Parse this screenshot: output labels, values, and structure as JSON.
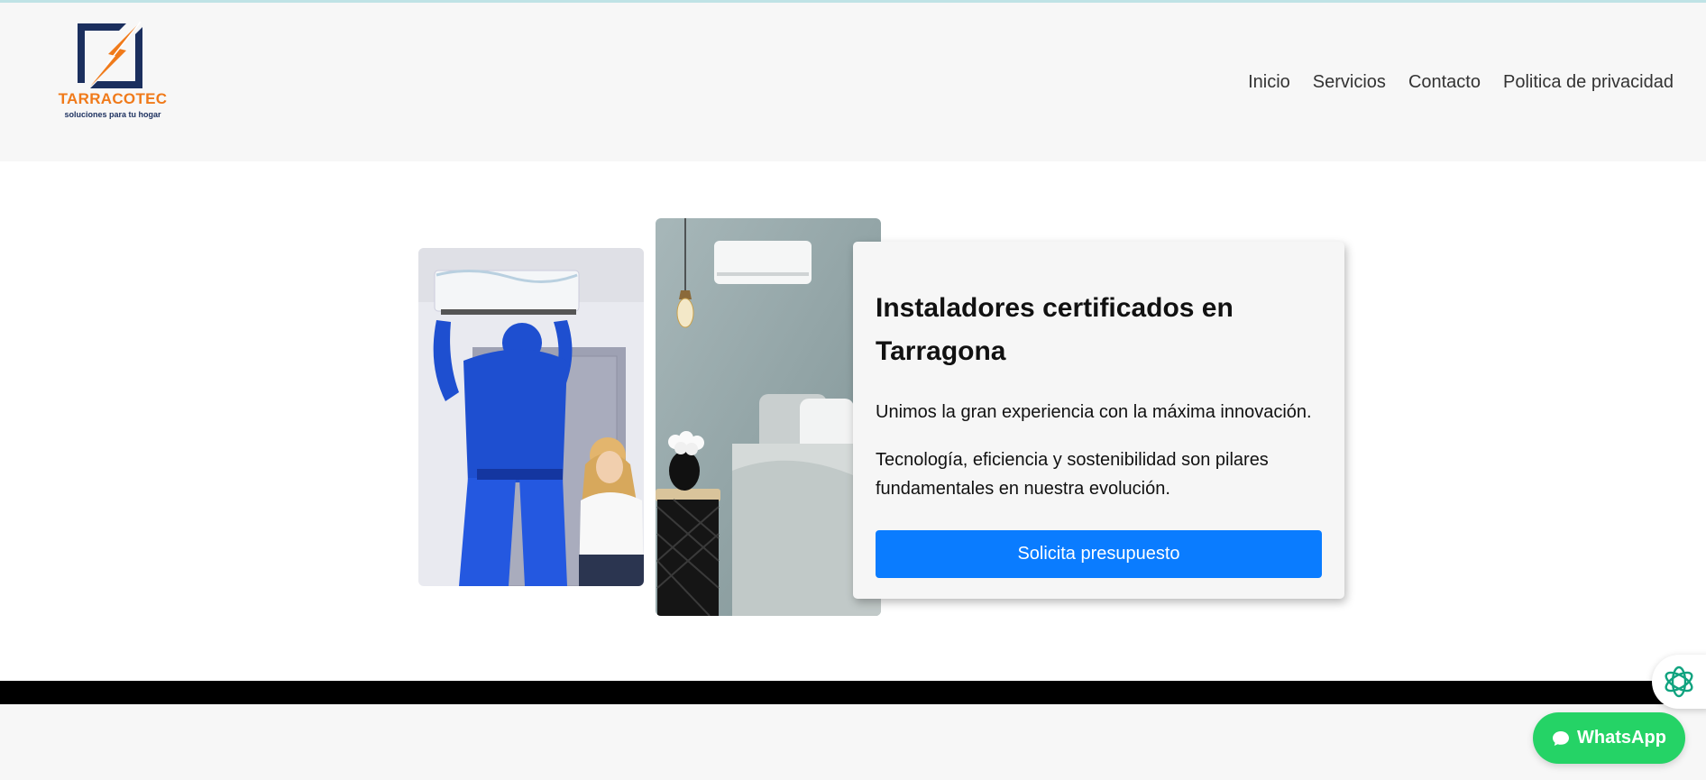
{
  "header": {
    "logo": {
      "name": "TARRACOTEC",
      "tagline": "soluciones para tu hogar"
    },
    "nav": [
      {
        "label": "Inicio"
      },
      {
        "label": "Servicios"
      },
      {
        "label": "Contacto"
      },
      {
        "label": "Politica de privacidad"
      }
    ]
  },
  "hero": {
    "images": [
      {
        "icon": "technician-installing-ac-photo"
      },
      {
        "icon": "bedroom-with-ac-unit-photo"
      }
    ],
    "card": {
      "title": "Instaladores certificados en Tarragona",
      "paragraph_1": "Unimos la gran experiencia con la máxima innovación.",
      "paragraph_2": "Tecnología, eficiencia y sostenibilidad son pilares fundamentales en nuestra evolución.",
      "cta_label": "Solicita presupuesto"
    }
  },
  "floating": {
    "whatsapp_label": "WhatsApp",
    "ai_icon": "openai-chat-icon"
  },
  "colors": {
    "brand_orange": "#f07a1a",
    "brand_navy": "#1b2f5e",
    "cta_blue": "#0a7cff",
    "whatsapp_green": "#25d366",
    "header_bg": "#f7f7f7"
  }
}
